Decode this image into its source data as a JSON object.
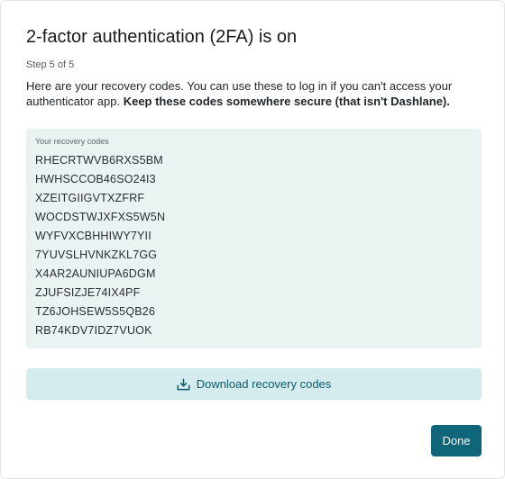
{
  "dialog": {
    "title": "2-factor authentication (2FA) is on",
    "step": "Step 5 of 5",
    "description_plain": "Here are your recovery codes. You can use these to log in if you can't access your authenticator app. ",
    "description_bold": "Keep these codes somewhere secure (that isn't Dashlane)."
  },
  "recovery": {
    "label": "Your recovery codes",
    "codes": [
      "RHECRTWVB6RXS5BM",
      "HWHSCCOB46SO24I3",
      "XZEITGIIGVTXZFRF",
      "WOCDSTWJXFXS5W5N",
      "WYFVXCBHHIWY7YII",
      "7YUVSLHVNKZKL7GG",
      "X4AR2AUNIUPA6DGM",
      "ZJUFSIZJE74IX4PF",
      "TZ6JOHSEW5S5QB26",
      "RB74KDV7IDZ7VUOK"
    ]
  },
  "actions": {
    "download_label": "Download recovery codes",
    "download_icon": "download-tray-icon",
    "done_label": "Done"
  },
  "colors": {
    "accent": "#0e6678",
    "download_bg": "#d5ecef",
    "codes_bg": "#ebf2f2"
  }
}
